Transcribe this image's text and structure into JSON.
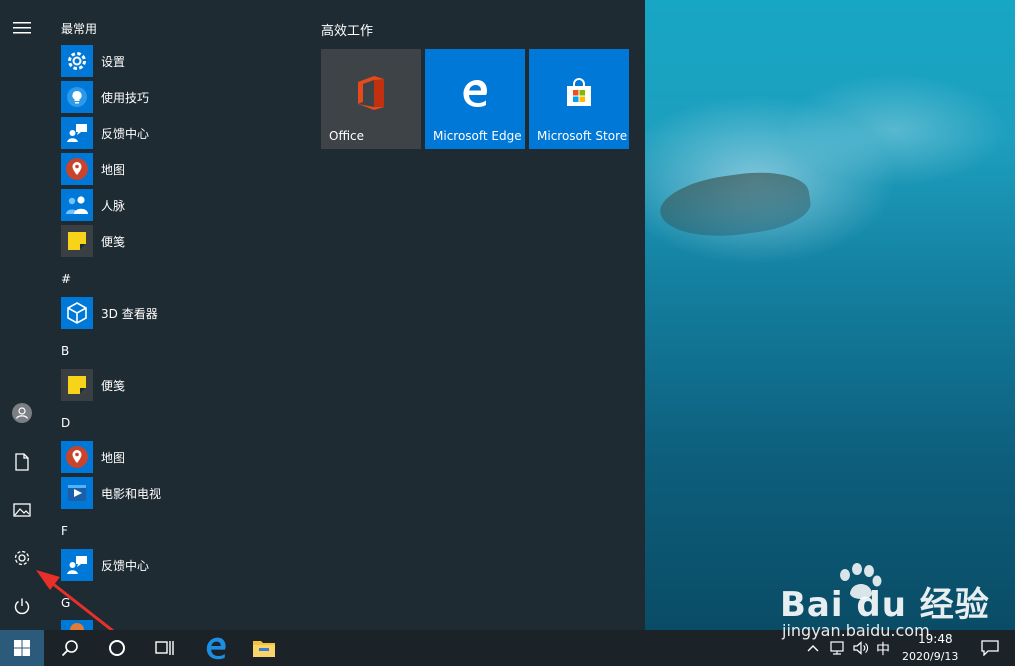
{
  "start_menu": {
    "recent_header": "最常用",
    "recent_apps": [
      {
        "label": "设置",
        "icon": "settings-gear-icon"
      },
      {
        "label": "使用技巧",
        "icon": "lightbulb-icon"
      },
      {
        "label": "反馈中心",
        "icon": "feedback-hub-icon"
      },
      {
        "label": "地图",
        "icon": "map-pin-icon"
      },
      {
        "label": "人脉",
        "icon": "people-icon"
      },
      {
        "label": "便笺",
        "icon": "sticky-note-icon"
      }
    ],
    "sections": [
      {
        "letter": "#",
        "apps": [
          {
            "label": "3D 查看器",
            "icon": "cube-icon"
          }
        ]
      },
      {
        "letter": "B",
        "apps": [
          {
            "label": "便笺",
            "icon": "sticky-note-icon"
          }
        ]
      },
      {
        "letter": "D",
        "apps": [
          {
            "label": "地图",
            "icon": "map-pin-icon"
          },
          {
            "label": "电影和电视",
            "icon": "film-play-icon"
          }
        ]
      },
      {
        "letter": "F",
        "apps": [
          {
            "label": "反馈中心",
            "icon": "feedback-hub-icon"
          }
        ]
      },
      {
        "letter": "G",
        "apps": []
      }
    ],
    "tiles_group_title": "高效工作",
    "tiles": [
      {
        "label": "Office",
        "color": "#3e4347",
        "icon": "office-logo-icon"
      },
      {
        "label": "Microsoft Edge",
        "color": "#0078d7",
        "icon": "edge-logo-icon"
      },
      {
        "label": "Microsoft Store",
        "color": "#0078d7",
        "icon": "store-bag-icon"
      }
    ],
    "rail": [
      "hamburger-menu-icon",
      "user-avatar-icon",
      "documents-icon",
      "pictures-icon",
      "settings-icon",
      "power-icon"
    ]
  },
  "taskbar": {
    "input_method": "中",
    "time": "19:48",
    "date": "2020/9/13"
  },
  "colors": {
    "accent": "#0078d7",
    "menu_bg": "#1f2b33",
    "taskbar_bg": "#1b2329",
    "annotation_arrow": "#e8302a"
  },
  "watermark": {
    "brand": "Bai du 经验",
    "url": "jingyan.baidu.com"
  }
}
